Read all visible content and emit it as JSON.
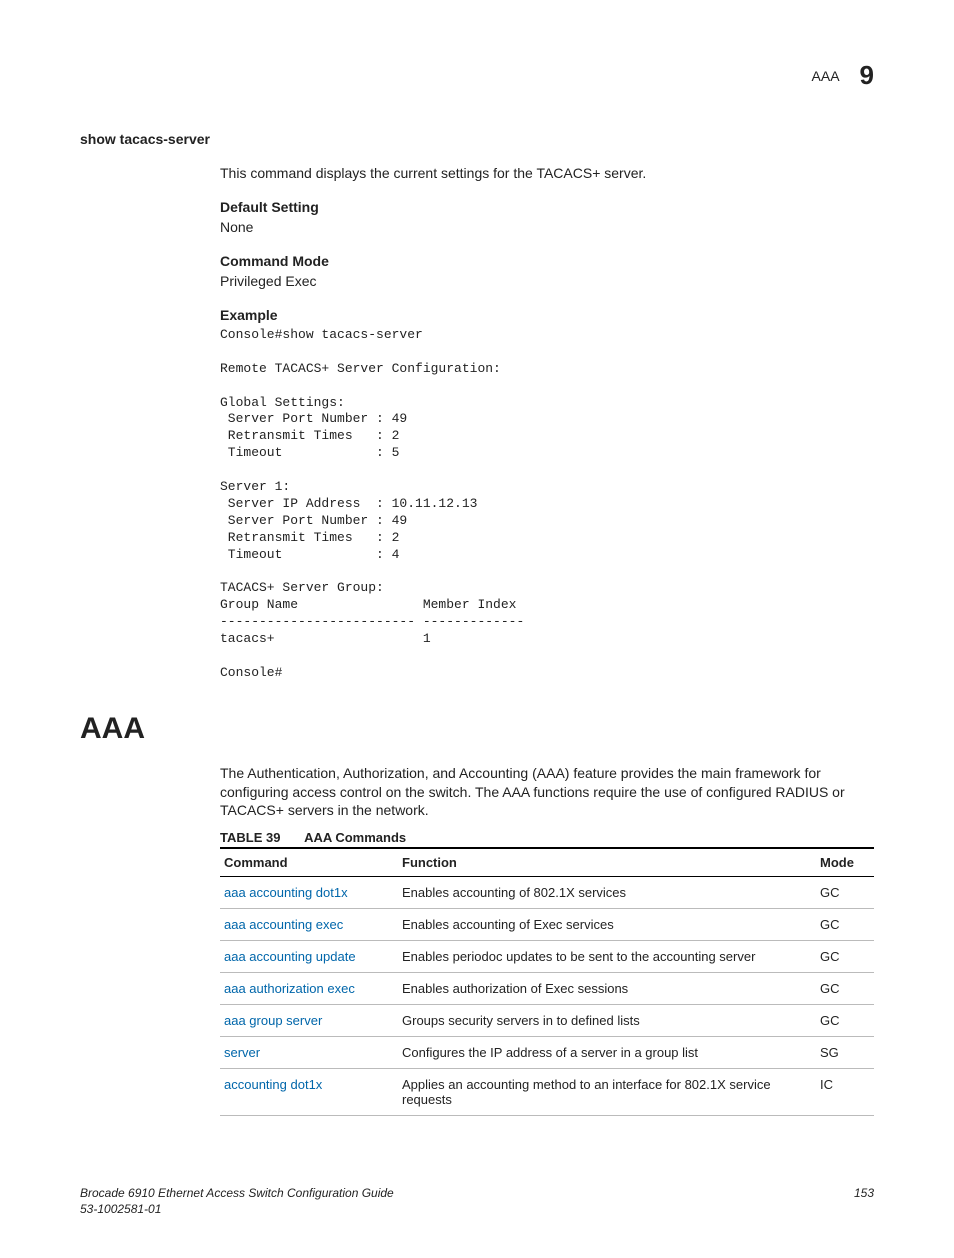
{
  "header": {
    "section": "AAA",
    "chapter": "9"
  },
  "cmd": {
    "title": "show tacacs-server",
    "desc": "This command displays the current settings for the TACACS+ server.",
    "default_label": "Default Setting",
    "default_value": "None",
    "mode_label": "Command Mode",
    "mode_value": "Privileged Exec",
    "example_label": "Example",
    "example_code": "Console#show tacacs-server\n\nRemote TACACS+ Server Configuration:\n\nGlobal Settings:\n Server Port Number : 49\n Retransmit Times   : 2\n Timeout            : 5\n\nServer 1:\n Server IP Address  : 10.11.12.13\n Server Port Number : 49\n Retransmit Times   : 2\n Timeout            : 4\n\nTACACS+ Server Group:\nGroup Name                Member Index\n------------------------- -------------\ntacacs+                   1\n\nConsole#"
  },
  "aaa": {
    "title": "AAA",
    "intro": "The Authentication, Authorization, and Accounting (AAA) feature provides the main framework for configuring access control on the switch. The AAA functions require the use of configured RADIUS or TACACS+ servers in the network.",
    "table_num": "TABLE 39",
    "table_title": "AAA Commands",
    "th": {
      "command": "Command",
      "function": "Function",
      "mode": "Mode"
    },
    "rows": [
      {
        "cmd": "aaa accounting dot1x",
        "func": "Enables accounting of 802.1X services",
        "mode": "GC"
      },
      {
        "cmd": "aaa accounting exec",
        "func": "Enables accounting of Exec services",
        "mode": "GC"
      },
      {
        "cmd": "aaa accounting update",
        "func": "Enables periodoc updates to be sent to the accounting server",
        "mode": "GC"
      },
      {
        "cmd": "aaa authorization exec",
        "func": "Enables authorization of Exec sessions",
        "mode": "GC"
      },
      {
        "cmd": "aaa group server",
        "func": "Groups security servers in to defined lists",
        "mode": "GC"
      },
      {
        "cmd": "server",
        "func": "Configures the IP address of a server in a group list",
        "mode": "SG"
      },
      {
        "cmd": "accounting dot1x",
        "func": "Applies an accounting method to an interface for 802.1X service requests",
        "mode": "IC"
      }
    ]
  },
  "footer": {
    "line1": "Brocade 6910 Ethernet Access Switch Configuration Guide",
    "line2": "53-1002581-01",
    "page": "153"
  }
}
